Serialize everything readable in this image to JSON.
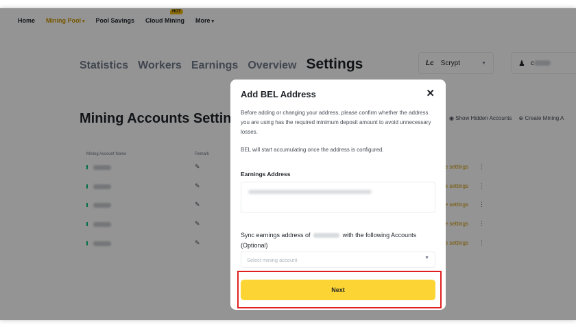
{
  "nav": {
    "home": "Home",
    "mining_pool": "Mining Pool",
    "pool_savings": "Pool Savings",
    "cloud_mining": "Cloud Mining",
    "hot_badge": "HOT",
    "more": "More"
  },
  "tabs": [
    "Statistics",
    "Workers",
    "Earnings",
    "Overview",
    "Settings"
  ],
  "algo_select": {
    "logo": "Lc",
    "value": "Scrypt"
  },
  "user": {
    "initial": "c"
  },
  "section": {
    "title": "Mining Accounts Setting",
    "show_hidden": "Show Hidden Accounts",
    "create": "Create Mining A"
  },
  "table": {
    "col_name": "Mining Account Name",
    "col_remark": "Remark",
    "row_more_label": "re settings"
  },
  "modal": {
    "title": "Add BEL Address",
    "close": "✕",
    "description": "Before adding or changing your address, please confirm whether the address you are using has the required minimum deposit amount to avoid unnecessary losses.",
    "note": "BEL will start accumulating once the address is configured.",
    "earnings_label": "Earnings Address",
    "sync_label_prefix": "Sync earnings address of",
    "sync_label_suffix": "with the following Accounts (Optional)",
    "select_placeholder": "Select mining account",
    "next_button": "Next"
  },
  "colors": {
    "accent": "#fcd535",
    "nav_active": "#c99400",
    "highlight_border": "#e02020",
    "status_green": "#02c076"
  },
  "icons": [
    "close-icon",
    "edit-icon",
    "more-dots-icon",
    "eye-icon",
    "plus-circle-icon",
    "user-icon",
    "chevron-down-icon"
  ]
}
